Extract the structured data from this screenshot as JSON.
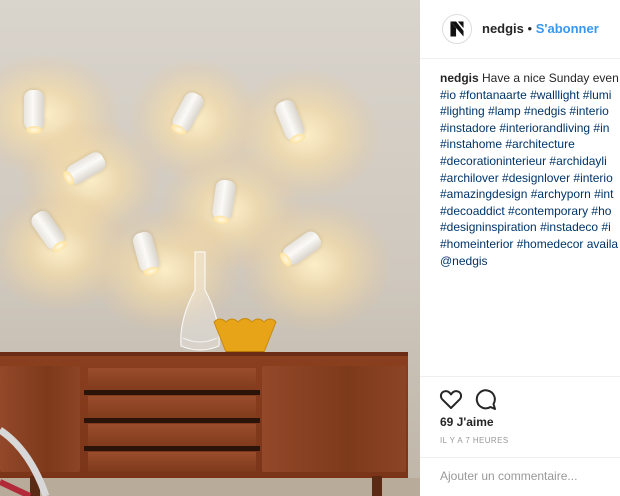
{
  "post": {
    "username": "nedgis",
    "separator": "•",
    "follow_label": "S'abonner",
    "caption_lines": [
      "Have a nice Sunday even",
      "#io #fontanaarte #walllight #lumi",
      "#lighting #lamp #nedgis #interio",
      "#instadore #interiorandliving #in",
      "#instahome #architecture",
      "#decorationinterieur #archidayli",
      "#archilover #designlover #interio",
      "#amazingdesign #archyporn #int",
      "#decoaddict #contemporary #ho",
      "#designinspiration #instadeco #i",
      "#homeinterior #homedecor availa",
      "@nedgis"
    ],
    "likes": "69 J'aime",
    "timestamp": "IL Y A 7 HEURES",
    "comment_placeholder": "Ajouter un commentaire..."
  },
  "icons": {
    "brand": "nedgis-logo-icon",
    "like": "heart-icon",
    "comment": "speech-bubble-icon"
  },
  "colors": {
    "link": "#3897f0",
    "hashtag": "#003569",
    "text": "#262626",
    "muted": "#999999",
    "sideboard": "#7a3418"
  }
}
